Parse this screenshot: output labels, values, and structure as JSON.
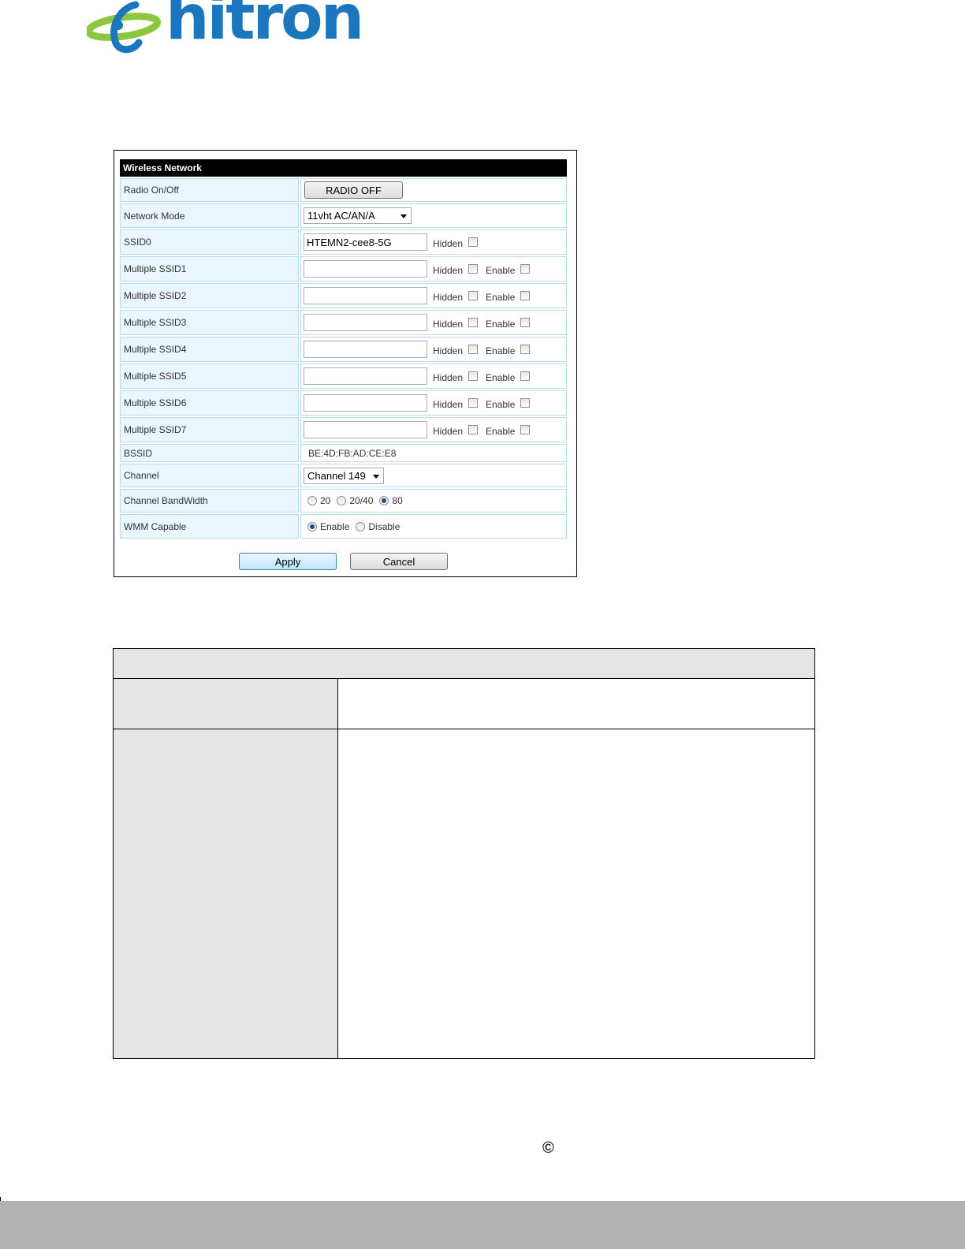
{
  "logo": {
    "text": "hitron"
  },
  "panel": {
    "title": "Wireless Network",
    "rows": [
      {
        "label": "Radio On/Off",
        "button": "RADIO OFF"
      },
      {
        "label": "Network Mode",
        "select": "11vht AC/AN/A"
      },
      {
        "label": "SSID0",
        "value": "HTEMN2-cee8-5G",
        "hidden_label": "Hidden"
      },
      {
        "label": "Multiple SSID1",
        "value": "",
        "hidden_label": "Hidden",
        "enable_label": "Enable"
      },
      {
        "label": "Multiple SSID2",
        "value": "",
        "hidden_label": "Hidden",
        "enable_label": "Enable"
      },
      {
        "label": "Multiple SSID3",
        "value": "",
        "hidden_label": "Hidden",
        "enable_label": "Enable"
      },
      {
        "label": "Multiple SSID4",
        "value": "",
        "hidden_label": "Hidden",
        "enable_label": "Enable"
      },
      {
        "label": "Multiple SSID5",
        "value": "",
        "hidden_label": "Hidden",
        "enable_label": "Enable"
      },
      {
        "label": "Multiple SSID6",
        "value": "",
        "hidden_label": "Hidden",
        "enable_label": "Enable"
      },
      {
        "label": "Multiple SSID7",
        "value": "",
        "hidden_label": "Hidden",
        "enable_label": "Enable"
      },
      {
        "label": "BSSID",
        "text": "BE:4D:FB:AD:CE:E8"
      },
      {
        "label": "Channel",
        "select": "Channel 149"
      },
      {
        "label": "Channel BandWidth",
        "options": [
          "20",
          "20/40",
          "80"
        ],
        "selected": "80"
      },
      {
        "label": "WMM Capable",
        "options": [
          "Enable",
          "Disable"
        ],
        "selected": "Enable"
      }
    ],
    "apply_label": "Apply",
    "cancel_label": "Cancel"
  },
  "copyright_symbol": "©",
  "colors": {
    "brand_blue": "#1b76bd",
    "brand_green": "#8dc63f",
    "label_bg": "#e9f6fd",
    "footer_bar": "#b3b3b3"
  }
}
